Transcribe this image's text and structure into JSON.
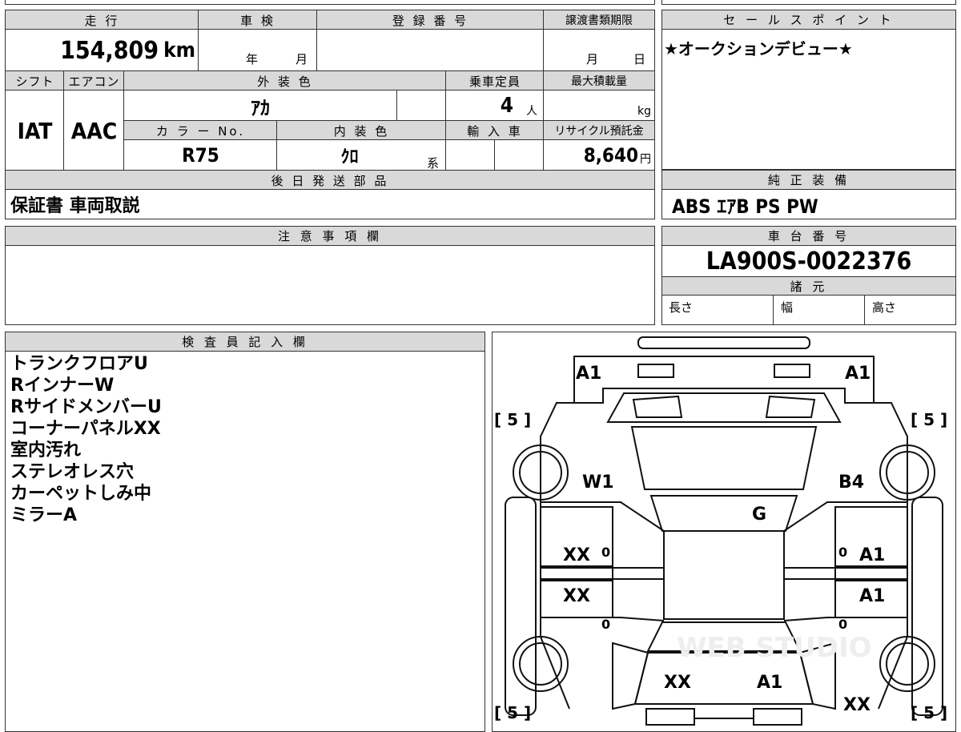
{
  "top": {
    "mileage": {
      "label": "走 行",
      "value": "154,809",
      "unit": "km"
    },
    "inspection": {
      "label": "車 検",
      "year": "年",
      "month": "月"
    },
    "registration": {
      "label": "登 録 番 号",
      "value": ""
    },
    "transfer_deadline": {
      "label": "譲渡書類期限",
      "month": "月",
      "day": "日"
    },
    "shift": {
      "label": "シフト",
      "value": "IAT"
    },
    "aircon": {
      "label": "エアコン",
      "value": "AAC"
    },
    "exterior_color": {
      "label": "外 装 色",
      "value": "ｱｶ"
    },
    "capacity": {
      "label": "乗車定員",
      "value": "4",
      "unit": "人"
    },
    "max_load": {
      "label": "最大積載量",
      "unit": "kg"
    },
    "color_no": {
      "label": "カ ラ ー No.",
      "value": "R75"
    },
    "interior_color": {
      "label": "内 装 色",
      "value": "ｸﾛ",
      "suffix": "系"
    },
    "import": {
      "label": "輸 入 車"
    },
    "recycle": {
      "label": "リサイクル預託金",
      "value": "8,640",
      "unit": "円"
    },
    "later_shipping": {
      "label": "後 日 発 送 部 品",
      "value": "保証書 車両取説"
    }
  },
  "sales_point": {
    "label": "セ ー ル ス ポ イ ン ト",
    "value": "★オークションデビュー★"
  },
  "genuine_equipment": {
    "label": "純 正 装 備",
    "value": "ABS ｴｱB PS PW"
  },
  "notes": {
    "label": "注 意 事 項 欄",
    "value": ""
  },
  "chassis": {
    "label": "車 台 番 号",
    "value": "LA900S-0022376"
  },
  "specs": {
    "label": "諸 元",
    "length": "長さ",
    "width": "幅",
    "height": "高さ"
  },
  "inspector": {
    "label": "検 査 員 記 入 欄",
    "lines": [
      "トランクフロアU",
      "RインナーW",
      "RサイドメンバーU",
      "コーナーパネルXX",
      "室内汚れ",
      "ステレオレス穴",
      "カーペットしみ中",
      "ミラーA"
    ]
  },
  "diagram": {
    "marks": {
      "front_left": "A1",
      "front_right": "A1",
      "tire_fl": "[ 5 ]",
      "tire_fr": "[ 5 ]",
      "tire_rl": "[ 5 ]",
      "tire_rr": "[ 5 ]",
      "left_fender": "W1",
      "right_fender": "B4",
      "roof": "G",
      "front_door_left": "XX",
      "front_door_left_zero": "0",
      "rear_door_left": "XX",
      "rear_door_left_zero": "0",
      "front_door_right": "A1",
      "front_door_right_zero": "0",
      "rear_door_right": "A1",
      "rear_door_right_zero": "0",
      "rear_center_left": "XX",
      "rear_center_right": "A1",
      "rear_right_corner": "XX"
    },
    "watermark": "WEB STUDIO"
  }
}
